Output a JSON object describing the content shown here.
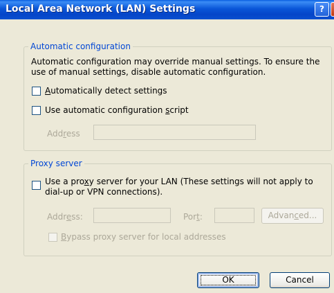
{
  "window": {
    "title": "Local Area Network (LAN) Settings",
    "help_glyph": "?",
    "close_glyph": "×"
  },
  "automatic": {
    "legend": "Automatic configuration",
    "desc_line1": "Automatic configuration may override manual settings.  To ensure the",
    "desc_line2": "use of manual settings, disable automatic configuration.",
    "detect_label_mnemonic": "A",
    "detect_label_rest": "utomatically detect settings",
    "detect_checked": false,
    "script_label_pre": "Use automatic configuration ",
    "script_label_mnemonic": "s",
    "script_label_post": "cript",
    "script_checked": false,
    "address_label_pre": "Add",
    "address_label_mnemonic": "r",
    "address_label_post": "ess",
    "address_value": ""
  },
  "proxy": {
    "legend": "Proxy server",
    "use_label_line1_pre": "Use a pro",
    "use_label_line1_mnemonic": "x",
    "use_label_line1_post": "y server for your LAN (These settings will not apply to",
    "use_label_line2": "dial-up or VPN connections).",
    "use_checked": false,
    "address_label_pre": "Addr",
    "address_label_mnemonic": "e",
    "address_label_post": "ss:",
    "address_value": "",
    "port_label_pre": "Por",
    "port_label_mnemonic": "t",
    "port_label_post": ":",
    "port_value": "",
    "advanced_pre": "Advan",
    "advanced_mnemonic": "c",
    "advanced_post": "ed...",
    "bypass_label_mnemonic": "B",
    "bypass_label_rest": "ypass proxy server for local addresses",
    "bypass_checked": false
  },
  "buttons": {
    "ok": "OK",
    "cancel": "Cancel"
  },
  "colors": {
    "dialog_bg": "#ece9d8",
    "group_legend": "#0046d5",
    "disabled_text": "#aca899",
    "title_bar": "#0a56d8"
  }
}
